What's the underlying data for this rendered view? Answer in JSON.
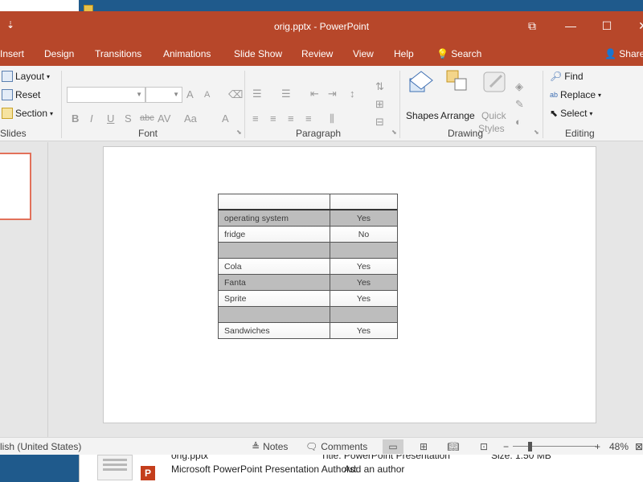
{
  "window": {
    "title": "orig.pptx  -  PowerPoint",
    "quick_access": "⇣",
    "buttons": {
      "restore_ribbon": "⧉",
      "maximize": "☐",
      "close": "✕"
    }
  },
  "tabs": [
    "Insert",
    "Design",
    "Transitions",
    "Animations",
    "Slide Show",
    "Review",
    "View",
    "Help"
  ],
  "tell_me": "Search",
  "share": "Share",
  "ribbon": {
    "slides": {
      "layout": "Layout",
      "reset": "Reset",
      "section": "Section",
      "label": "Slides"
    },
    "font": {
      "label": "Font",
      "bold": "B",
      "italic": "I",
      "underline": "U",
      "shadow": "S",
      "strike": "abc",
      "spacing": "AV",
      "case": "Aa",
      "color": "A",
      "grow": "A",
      "shrink": "A"
    },
    "paragraph": {
      "label": "Paragraph"
    },
    "drawing": {
      "label": "Drawing",
      "shapes": "Shapes",
      "arrange": "Arrange",
      "quick_styles_1": "Quick",
      "quick_styles_2": "Styles"
    },
    "editing": {
      "label": "Editing",
      "find": "Find",
      "replace": "Replace",
      "select": "Select"
    }
  },
  "slide_table": {
    "rows": [
      {
        "c1": "",
        "c2": "",
        "shaded": false,
        "header": true
      },
      {
        "c1": "operating system",
        "c2": "Yes",
        "shaded": true
      },
      {
        "c1": "fridge",
        "c2": "No",
        "shaded": false
      },
      {
        "c1": "",
        "c2": "",
        "shaded": true
      },
      {
        "c1": "Cola",
        "c2": "Yes",
        "shaded": false
      },
      {
        "c1": "Fanta",
        "c2": "Yes",
        "shaded": true
      },
      {
        "c1": "Sprite",
        "c2": "Yes",
        "shaded": false
      },
      {
        "c1": "",
        "c2": "",
        "shaded": true
      },
      {
        "c1": "Sandwiches",
        "c2": "Yes",
        "shaded": false
      }
    ]
  },
  "statusbar": {
    "language": "lish (United States)",
    "notes": "Notes",
    "comments": "Comments",
    "zoom": "48%"
  },
  "explorer_details": {
    "filename": "orig.pptx",
    "title_field": "Title: PowerPoint Presentation",
    "size_field": "Size: 1.50 MB",
    "type_line": "Microsoft PowerPoint Presentation Authors:",
    "author": "Add an author"
  }
}
